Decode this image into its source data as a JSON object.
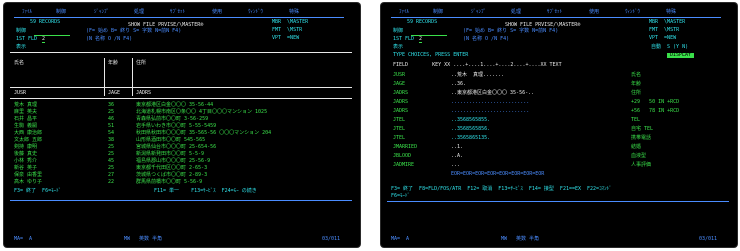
{
  "left": {
    "menu": [
      "ﾌｧｲﾙ",
      "制御",
      "ｼﾞｬﾝﾌﾟ",
      "処理",
      "ｻﾌﾞｾｯﾄ",
      "使用",
      "ｳｨﾝﾄﾞｳ",
      "特殊"
    ],
    "record_count": "59 RECORDS",
    "title": "SHOW FILE PRVISE/\\MASTER®",
    "mbr": "MBR  \\MASTER",
    "ctrl_label": "制御",
    "ctrl_hint": "(F= 始め B= 終り S= 字数 N=前N F4)",
    "fmt": "FMT  \\MSTR",
    "fld_label": "1ST FLD",
    "fld_value": "2",
    "fld_hint": "(N 名称 O /N F4)",
    "vpt": "VPT  =NEW",
    "display_label": "表示",
    "col_name": "氏名",
    "col_age": "年齢",
    "col_addr": "住所",
    "fld_name": "JUSR",
    "fld_age": "JAGE",
    "fld_addr": "JADRS",
    "rows": [
      {
        "name": "荒木 真理",
        "age": "36",
        "addr": "東京都港区白金〇〇〇 35-56-44"
      },
      {
        "name": "麻里 英夫",
        "age": "25",
        "addr": "北海道札幌市南区〇条〇〇 4丁目〇〇〇マンション 1025"
      },
      {
        "name": "石井 昌平",
        "age": "46",
        "addr": "青森県弘前市〇〇町 3-56-259"
      },
      {
        "name": "生駒 義嗣",
        "age": "51",
        "addr": "岩手県いわき市〇〇町 5-55-5459"
      },
      {
        "name": "大西 康治郎",
        "age": "54",
        "addr": "秋田県秋田市〇〇〇町 35-565-56 〇〇〇マンション 204"
      },
      {
        "name": "文太郎 五郎",
        "age": "38",
        "addr": "山形県酒田市〇〇町 545-565"
      },
      {
        "name": "剣持 康明",
        "age": "25",
        "addr": "宮城県仙台市〇〇〇町 25-654-56"
      },
      {
        "name": "後藤 真史",
        "age": "25",
        "addr": "新潟県新発田市〇〇町 5-5-9"
      },
      {
        "name": "小林 秀介",
        "age": "45",
        "addr": "福島県郡山市〇〇〇町 25-56-9"
      },
      {
        "name": "新谷 英子",
        "age": "25",
        "addr": "東京都千代田区〇〇町 2-65-3"
      },
      {
        "name": "保泉 由香里",
        "age": "27",
        "addr": "茨城県つくば市〇〇町 2-89-3"
      },
      {
        "name": "高木 ゆり子",
        "age": "22",
        "addr": "群馬県前橋市〇〇町 5-56-9"
      }
    ],
    "fkeys1": "F3= 終了  F6=ﾓｰﾄﾞ",
    "fkeys1b": "F11= 単一    F13=ｻｰﾋﾞｽ  F24=ﾓｰ の続き",
    "status_left": "MA=  A",
    "status_mid": "MW   英数 半角",
    "status_right": "03/011"
  },
  "right": {
    "menu": [
      "ﾌｧｲﾙ",
      "制御",
      "ｼﾞｬﾝﾌﾟ",
      "処理",
      "ｻﾌﾞｾｯﾄ",
      "使用",
      "ｳｨﾝﾄﾞｳ",
      "特殊"
    ],
    "record_count": "59 RECORDS",
    "title": "SHOW FILE PRVISE/\\MASTER®",
    "mbr": "MBR  \\MASTER",
    "ctrl_label": "制御",
    "ctrl_hint": "(F= 始め B= 終り S= 字数 N=前N F4)",
    "fmt": "FMT  \\MSTR",
    "fld_label": "1ST FLD",
    "fld_value": "2",
    "fld_hint": "(N 名称 O /N F4)",
    "vpt": "VPT  =NEW",
    "display_label": "表示",
    "auto_label": "自動  S (Y N)",
    "prompt": "TYPE CHOICES, PRESS ENTER",
    "display_button": "DISPLAY",
    "ruler_head": "FIELD        KEY XX ....+....1....+....2....+....XX TEXT",
    "fields": [
      {
        "name": "JUSR",
        "val": "..荒木  真理.......",
        "text": "氏名"
      },
      {
        "name": "JAGE",
        "val": "..36.",
        "text": "年齢"
      },
      {
        "name": "JADRS",
        "val": "..東京都港区白金〇〇〇 35-56-..",
        "text": "住所"
      },
      {
        "name": "JADRS",
        "val": "..........................",
        "text": "+29   50 IN +RCD"
      },
      {
        "name": "JADRS",
        "val": "..........................",
        "text": "+56   78 IN +RCD"
      },
      {
        "name": "JTEL",
        "val": "..3568565855.",
        "text": "TEL"
      },
      {
        "name": "JTEL",
        "val": "..3568565856.",
        "text": "自宅 TEL"
      },
      {
        "name": "JTEL",
        "val": "..3565865135.",
        "text": "携帯電話"
      },
      {
        "name": "JMARRIED",
        "val": "..1.",
        "text": "結婚"
      },
      {
        "name": "JBLOOD",
        "val": "..A.",
        "text": "血液型"
      },
      {
        "name": "JADMIRE",
        "val": "...",
        "text": "人事評価"
      }
    ],
    "eor": "EOR=EOR=EOR=EOR=EOR=EOR=EOR=EOR",
    "fkeys1": "F3= 終了  F8=FLD/FOS/ATR  F12= 取消  F13=ｻｰﾋﾞｽ  F14= 接型  F21==EX  F22=ｺﾏﾝﾄﾞ",
    "fkeys1b": "F6=ﾓｰﾄﾞ",
    "status_left": "MA=  A",
    "status_mid": "MW   英数 半角",
    "status_right": "03/011"
  }
}
